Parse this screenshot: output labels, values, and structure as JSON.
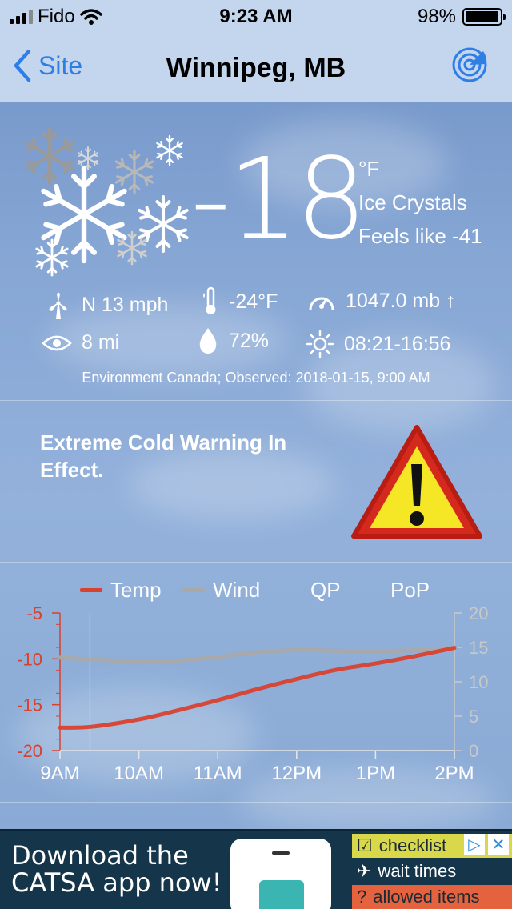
{
  "status_bar": {
    "carrier": "Fido",
    "time": "9:23 AM",
    "battery": "98%",
    "battery_level": 0.98
  },
  "nav": {
    "back_label": "Site",
    "title": "Winnipeg, MB",
    "radar_icon": "radar-icon"
  },
  "current": {
    "temperature": "-18",
    "unit": "°F",
    "condition": "Ice Crystals",
    "feels_like": "Feels like -41",
    "weather_icon": "snowflakes-icon"
  },
  "details": {
    "wind": "N 13 mph",
    "dewpoint": "-24°F",
    "pressure": "1047.0 mb ↑",
    "visibility": "8 mi",
    "humidity": "72%",
    "sun": "08:21-16:56"
  },
  "observation": "Environment Canada; Observed: 2018-01-15, 9:00 AM",
  "alert": {
    "text": "Extreme Cold Warning In Effect.",
    "icon": "warning-triangle-icon"
  },
  "legend": {
    "temp": "Temp",
    "wind": "Wind",
    "qp": "QP",
    "pop": "PoP"
  },
  "colors": {
    "temp_series": "#d9412f",
    "wind_series": "#a9a9a9",
    "left_axis": "#d9412f",
    "right_axis": "#c8c8c8",
    "nav_bar": "#c3d6ee",
    "link_blue": "#2f7ee6"
  },
  "chart_data": {
    "type": "line",
    "x": [
      "9AM",
      "10AM",
      "11AM",
      "12PM",
      "1PM",
      "2PM"
    ],
    "x_numeric": [
      0,
      1,
      2,
      3,
      4,
      5
    ],
    "series": [
      {
        "name": "Temp",
        "axis": "left",
        "x": [
          0,
          0.4,
          1,
          1.5,
          2,
          2.5,
          3,
          3.5,
          4,
          4.5,
          5
        ],
        "values": [
          -17.5,
          -17.4,
          -16.6,
          -15.6,
          -14.5,
          -13.3,
          -12.2,
          -11.2,
          -10.5,
          -9.7,
          -8.8
        ]
      },
      {
        "name": "Wind",
        "axis": "right",
        "x": [
          0,
          0.5,
          1,
          1.5,
          2,
          2.5,
          3,
          3.5,
          4,
          4.5,
          5
        ],
        "values": [
          13.5,
          13.2,
          13.0,
          13.1,
          13.6,
          14.3,
          14.6,
          14.5,
          14.4,
          14.6,
          15.0
        ]
      }
    ],
    "y_left": {
      "ticks": [
        "-5",
        "-10",
        "-15",
        "-20"
      ],
      "range": [
        -20,
        -5
      ]
    },
    "y_right": {
      "ticks": [
        "20",
        "15",
        "10",
        "5",
        "0"
      ],
      "range": [
        0,
        20
      ]
    },
    "grid": false
  },
  "ad": {
    "headline_line1": "Download the",
    "headline_line2": "CATSA app now!",
    "item1": "checklist",
    "item2": "wait times",
    "item3": "allowed items",
    "adchoices_icon": "adchoices-icon",
    "close_icon": "close-icon"
  }
}
